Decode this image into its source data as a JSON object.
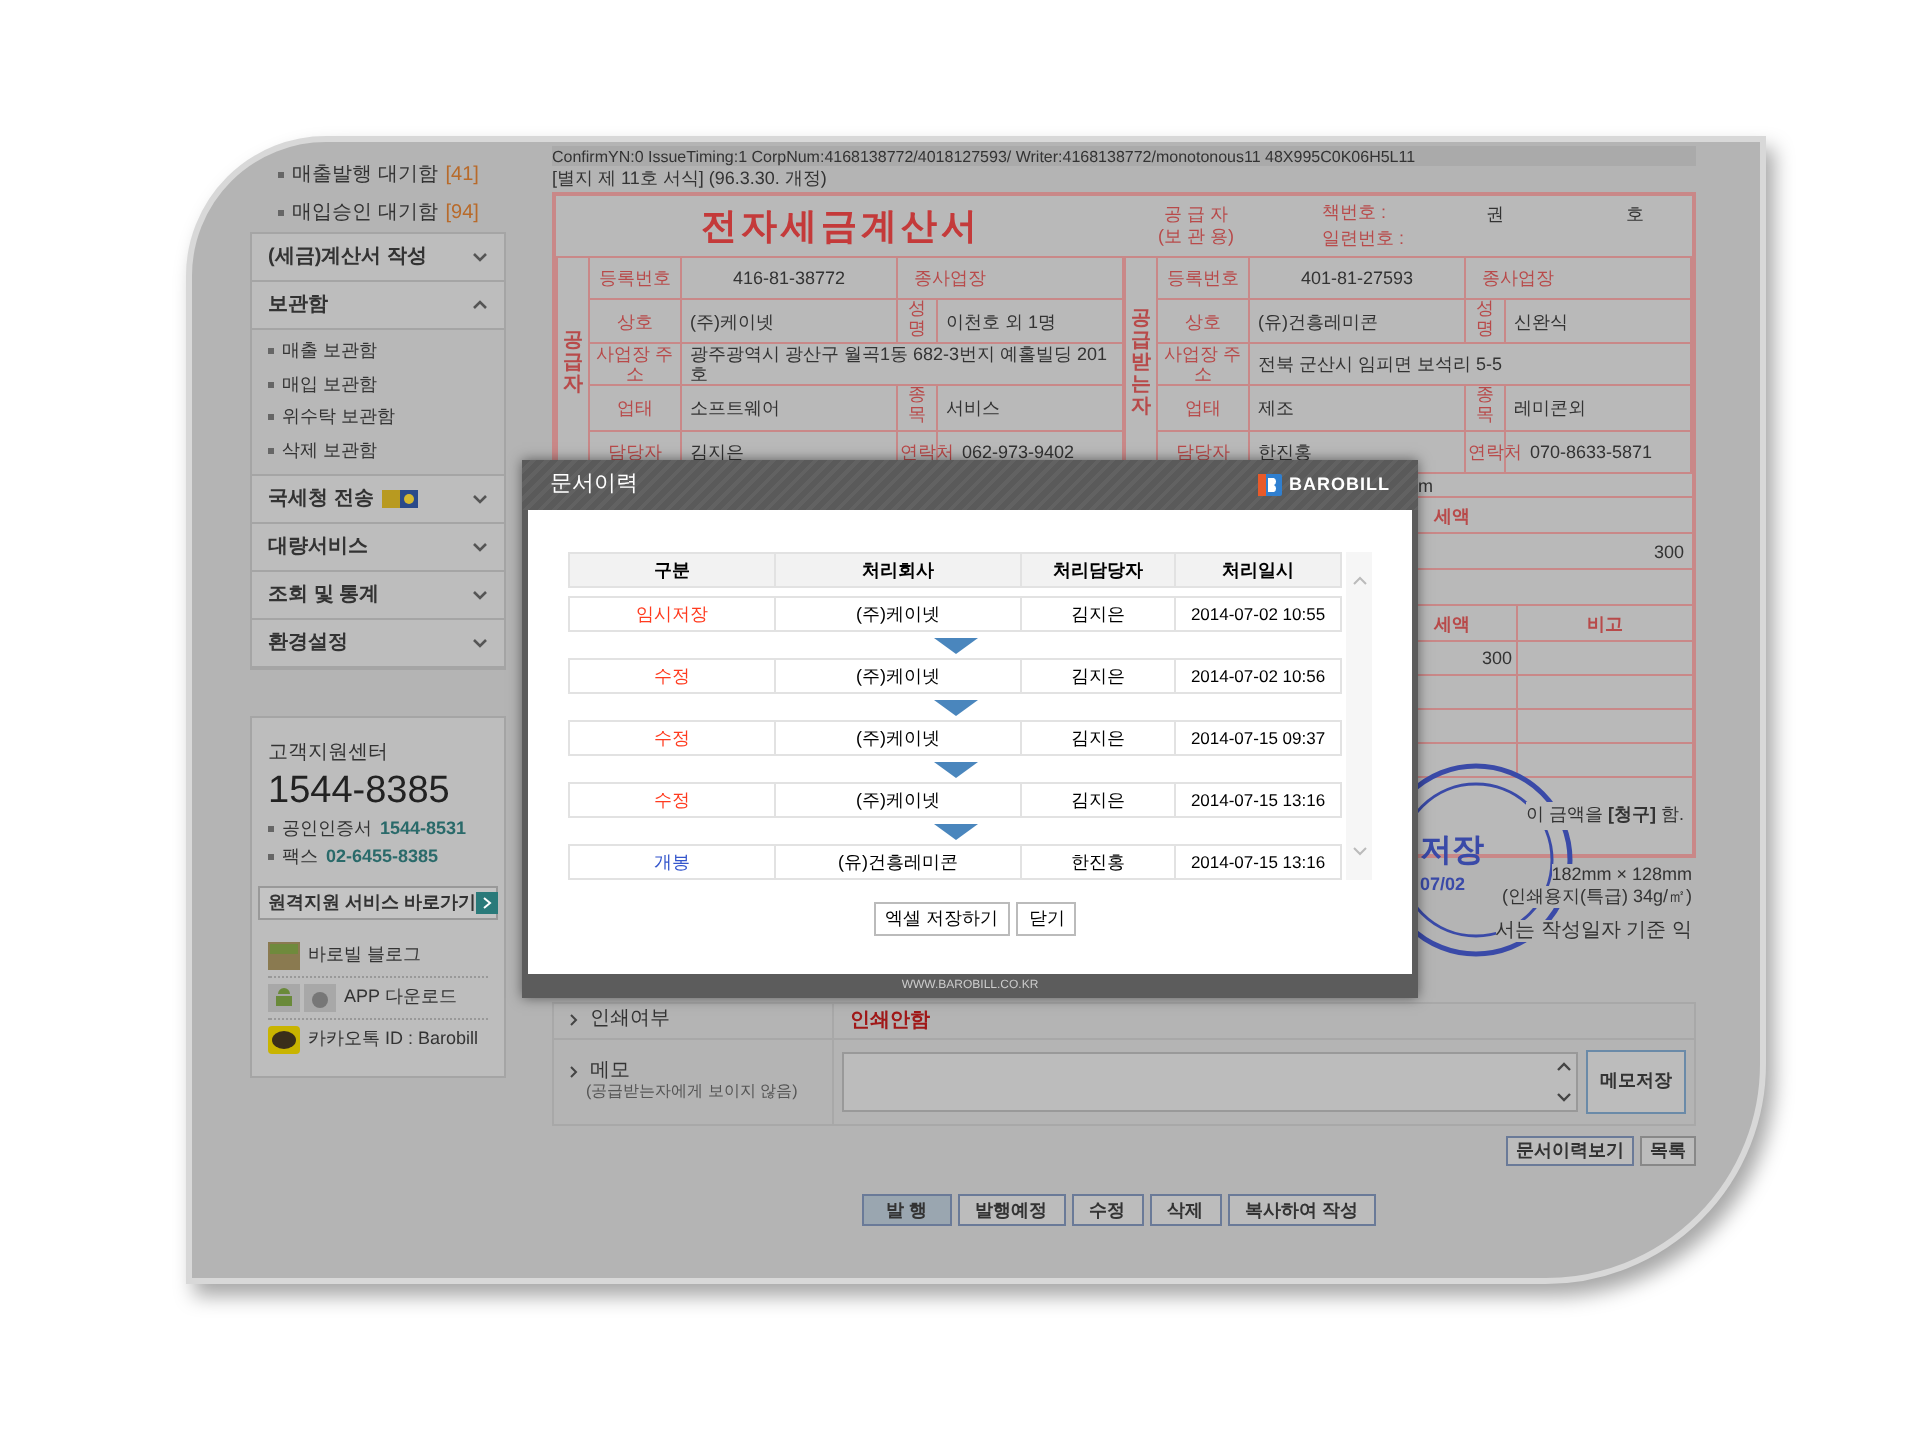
{
  "header_info": "ConfirmYN:0   IssueTiming:1   CorpNum:4168138772/4018127593/   Writer:4168138772/monotonous11   48X995C0K06H5L11",
  "form_note": "[별지 제 11호 서식] (96.3.30. 개정)",
  "sidebar": {
    "pending": [
      {
        "label": "매출발행 대기함",
        "count": "[41]"
      },
      {
        "label": "매입승인 대기함",
        "count": "[94]"
      }
    ],
    "menus": [
      {
        "label": "(세금)계산서 작성",
        "expanded": false
      },
      {
        "label": "보관함",
        "expanded": true,
        "children": [
          "매출 보관함",
          "매입 보관함",
          "위수탁 보관함",
          "삭제 보관함"
        ]
      },
      {
        "label": "국세청 전송",
        "expanded": false,
        "nts_badge": true
      },
      {
        "label": "대량서비스",
        "expanded": false
      },
      {
        "label": "조회 및 통계",
        "expanded": false
      },
      {
        "label": "환경설정",
        "expanded": false
      }
    ],
    "support": {
      "title": "고객지원센터",
      "phone": "1544-8385",
      "lines": [
        {
          "label": "공인인증서",
          "value": "1544-8531"
        },
        {
          "label": "팩스",
          "value": "02-6455-8385"
        }
      ],
      "remote_button": "원격지원 서비스 바로가기",
      "links": [
        {
          "kind": "blog",
          "label": "바로빌 블로그"
        },
        {
          "kind": "app",
          "label": "APP 다운로드"
        },
        {
          "kind": "kakao",
          "label": "카카오톡 ID : Barobill"
        }
      ]
    }
  },
  "invoice": {
    "title": "전자세금계산서",
    "copy_label": [
      "공 급 자",
      "(보 관 용)"
    ],
    "book_no_label": "책번호 :",
    "serial_label": "일련번호 :",
    "volume_label": "권",
    "number_label": "호",
    "parties": [
      {
        "side_label": "공급자",
        "reg_label": "등록번호",
        "reg_no": "416-81-38772",
        "branch_label": "종사업장",
        "name_label": "상호",
        "name": "(주)케이넷",
        "rep_label": "성명",
        "rep": "이천호 외 1명",
        "address_label": "사업장 주소",
        "address": "광주광역시 광산구 월곡1동 682-3번지 예홀빌딩 201호",
        "type_label": "업태",
        "type": "소프트웨어",
        "item_label": "종목",
        "item": "서비스",
        "contact_label": "담당자",
        "contact": "김지은",
        "phone_label": "연락처",
        "phone": "062-973-9402"
      },
      {
        "side_label": "공급받는자",
        "reg_label": "등록번호",
        "reg_no": "401-81-27593",
        "branch_label": "종사업장",
        "name_label": "상호",
        "name": "(유)건흥레미콘",
        "rep_label": "성명",
        "rep": "신완식",
        "address_label": "사업장 주소",
        "address": "전북 군산시 임피면 보석리 5-5",
        "type_label": "업태",
        "type": "제조",
        "item_label": "종목",
        "item": "레미콘외",
        "contact_label": "담당자",
        "contact": "한진홍",
        "phone_label": "연락처",
        "phone": "070-8633-5871"
      }
    ],
    "email_fragment": "m",
    "tax_header": "세액",
    "tax_total": "300",
    "item_tax_header": "세액",
    "note_header": "비고",
    "item_tax": "300",
    "claim_text": "이 금액을 **[청구]** 함.",
    "stamp": {
      "text": "저장",
      "date": "07/02"
    },
    "size_note": "182mm × 128mm",
    "paper_note": "(인쇄용지(특급) 34g/㎡)",
    "footer_fragment": "서는 작성일자 기준 익"
  },
  "details": {
    "print_label": "인쇄여부",
    "print_value": "인쇄안함",
    "memo_label": "메모",
    "memo_hint": "(공급받는자에게 보이지 않음)",
    "memo_save": "메모저장"
  },
  "actions": [
    "문서이력보기",
    "목록"
  ],
  "bottom_buttons": [
    {
      "label": "발 행",
      "primary": true
    },
    {
      "label": "발행예정",
      "primary": false
    },
    {
      "label": "수정",
      "primary": false
    },
    {
      "label": "삭제",
      "primary": false
    },
    {
      "label": "복사하여 작성",
      "primary": false
    }
  ],
  "modal": {
    "title": "문서이력",
    "logo": "BAROBILL",
    "columns": [
      "구분",
      "처리회사",
      "처리담당자",
      "처리일시"
    ],
    "rows": [
      {
        "kind_label": "임시저장",
        "color": "#ff3b1f",
        "company": "(주)케이넷",
        "person": "김지은",
        "time": "2014-07-02 10:55"
      },
      {
        "kind_label": "수정",
        "color": "#ff3b1f",
        "company": "(주)케이넷",
        "person": "김지은",
        "time": "2014-07-02 10:56"
      },
      {
        "kind_label": "수정",
        "color": "#ff3b1f",
        "company": "(주)케이넷",
        "person": "김지은",
        "time": "2014-07-15 09:37"
      },
      {
        "kind_label": "수정",
        "color": "#ff3b1f",
        "company": "(주)케이넷",
        "person": "김지은",
        "time": "2014-07-15 13:16"
      },
      {
        "kind_label": "개봉",
        "color": "#3355cc",
        "company": "(유)건흥레미콘",
        "person": "한진홍",
        "time": "2014-07-15 13:16"
      }
    ],
    "buttons": [
      "엑셀 저장하기",
      "닫기"
    ],
    "footer": "WWW.BAROBILL.CO.KR"
  }
}
